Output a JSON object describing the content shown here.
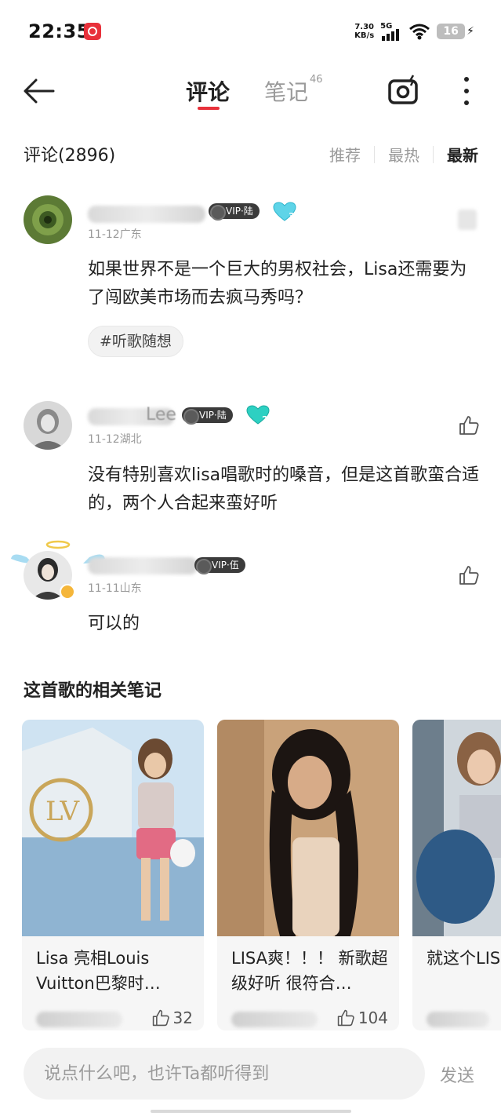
{
  "status_bar": {
    "time": "22:35",
    "net_speed_value": "7.30",
    "net_speed_unit": "KB/s",
    "network": "5G",
    "battery": "16",
    "app_icon": "netease-music-icon"
  },
  "nav": {
    "back_icon": "back-arrow-icon",
    "tab_comments": "评论",
    "tab_notes": "笔记",
    "tab_notes_count": "46",
    "camera_icon": "camera-icon",
    "more_icon": "more-vertical-icon",
    "accent_color": "#e8313b"
  },
  "comments_header": {
    "count_label": "评论(2896)",
    "sort_options": [
      "推荐",
      "最热",
      "最新"
    ],
    "active_sort": "最新"
  },
  "comments": [
    {
      "vip_label": "VIP·陆",
      "level": "3",
      "meta": "11-12广东",
      "text": "如果世界不是一个巨大的男权社会，Lisa还需要为了闯欧美市场而去疯马秀吗？",
      "hashtag": "#听歌随想"
    },
    {
      "name_fragment": "Lee",
      "vip_label": "VIP·陆",
      "level": "2",
      "meta": "11-12湖北",
      "text": "没有特别喜欢lisa唱歌时的嗓音，但是这首歌蛮合适的，两个人合起来蛮好听"
    },
    {
      "vip_label": "VIP·伍",
      "meta": "11-11山东",
      "text": "可以的"
    }
  ],
  "related": {
    "title": "这首歌的相关笔记",
    "notes": [
      {
        "title": "Lisa 亮相Louis Vuitton巴黎时…",
        "likes": "32"
      },
      {
        "title": "LISA爽！！！ 新歌超级好听 很符合…",
        "likes": "104"
      },
      {
        "title": "就这个LIS"
      }
    ]
  },
  "input_bar": {
    "placeholder": "说点什么吧，也许Ta都听得到",
    "send_label": "发送"
  }
}
